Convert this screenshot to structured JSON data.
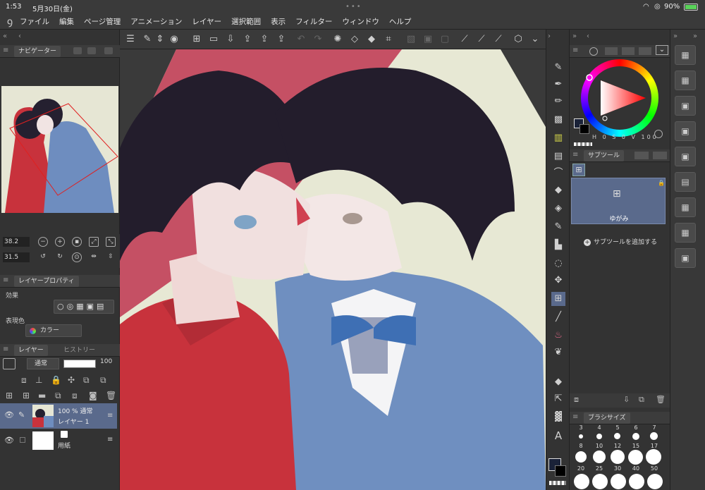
{
  "status": {
    "time": "1:53",
    "date": "5月30日(金)",
    "battery": "90%"
  },
  "menu": [
    "ファイル",
    "編集",
    "ページ管理",
    "アニメーション",
    "レイヤー",
    "選択範囲",
    "表示",
    "フィルター",
    "ウィンドウ",
    "ヘルプ"
  ],
  "navigator": {
    "tab": "ナビゲーター",
    "zoom": "38.2",
    "rotate": "31.5"
  },
  "layer_property": {
    "tab": "レイヤープロパティ",
    "effect_label": "効果",
    "color_label": "表現色",
    "color_value": "カラー"
  },
  "layers": {
    "tab": "レイヤー",
    "tab2": "ヒストリー",
    "blend": "通常",
    "opacity": "100",
    "items": [
      {
        "line1": "100 % 通常",
        "line2": "レイヤー 1"
      },
      {
        "line1": "",
        "line2": "用紙"
      }
    ]
  },
  "subtool": {
    "tab": "サブツール",
    "selected": "ゆがみ",
    "add_label": "サブツールを追加する"
  },
  "brushsize": {
    "tab": "ブラシサイズ",
    "row0": [
      "3",
      "4",
      "5",
      "6",
      "7"
    ],
    "row1": [
      "8",
      "10",
      "12",
      "15",
      "17"
    ],
    "row2": [
      "20",
      "25",
      "30",
      "40",
      "50"
    ]
  },
  "color_wheel": {
    "values": [
      "H",
      "0",
      "S",
      "0",
      "V",
      "100"
    ]
  },
  "colors": {
    "accent": "#5a6a8c",
    "red_jacket": "#c8323c",
    "blue_suit": "#6e8dbf",
    "wheel_marker": "#ffffff"
  }
}
